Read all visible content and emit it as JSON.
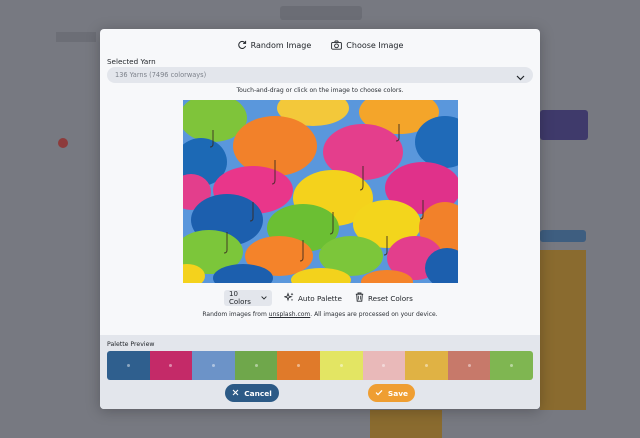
{
  "toolbar": {
    "random_label": "Random Image",
    "choose_label": "Choose Image"
  },
  "yarn": {
    "label": "Selected Yarn",
    "value": "136 Yarns (7496 colorways)"
  },
  "hint": "Touch-and-drag or click on the image to choose colors.",
  "photo": {
    "icon": "umbrellas-photo"
  },
  "controls": {
    "colors_value": "10 Colors",
    "auto_label": "Auto Palette",
    "reset_label": "Reset Colors"
  },
  "attribution": {
    "prefix": "Random images from ",
    "link": "unsplash.com",
    "suffix": ". All images are processed on your device."
  },
  "palette": {
    "label": "Palette Preview",
    "colors": [
      "#2f5f8e",
      "#c42a68",
      "#6c93c8",
      "#6fa74b",
      "#e07a2a",
      "#e3e563",
      "#e9b9b9",
      "#e0b244",
      "#c7796a",
      "#7fb651"
    ]
  },
  "footer": {
    "cancel_label": "Cancel",
    "save_label": "Save"
  },
  "colors": {
    "cancel_bg": "#2c5a86",
    "save_bg": "#ef9e32"
  }
}
